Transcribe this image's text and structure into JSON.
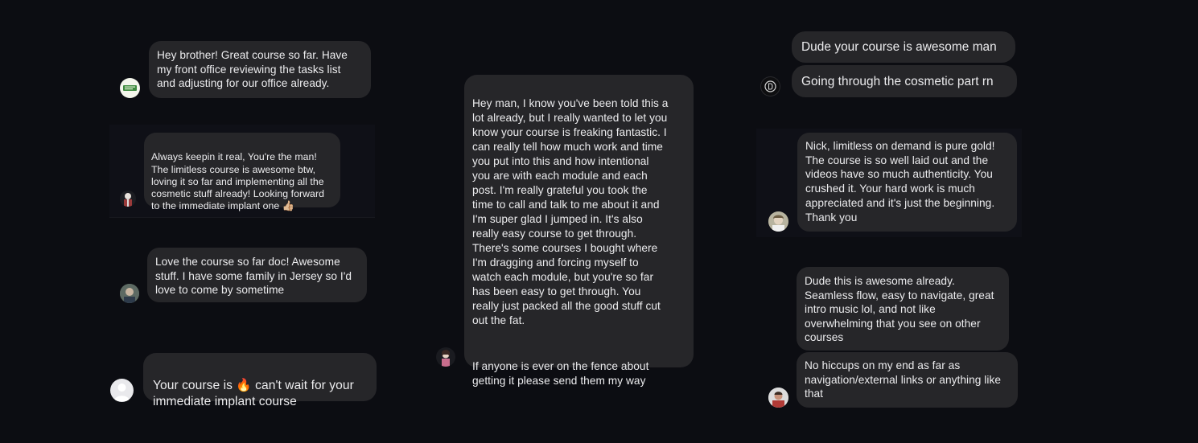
{
  "messages": {
    "m1": "Hey brother! Great course so far.  Have\nmy front office reviewing the tasks list\nand adjusting for our office already.",
    "m2": "Always keepin it real, You're the man!\nThe limitless course is awesome btw,\nloving it so far and implementing all the\ncosmetic stuff already! Looking forward\nto the immediate implant one",
    "m2_emoji": "👍🏼",
    "m3": "Love the course so far doc! Awesome\nstuff. I have some family in Jersey so I'd\nlove to come by sometime",
    "m4_part1": "Your course is ",
    "m4_emoji": "🔥",
    "m4_part2": " can't wait for your\nimmediate implant course",
    "m5_p1": "Hey man, I know you've been told this a\nlot already, but I really wanted to let you\nknow your course is freaking fantastic. I\ncan really tell how much work and time\nyou put into this and how intentional\nyou are with each module and each\npost.  I'm really grateful you took the\ntime to call and talk to me about it and\nI'm super glad I jumped in. It's also\nreally easy course to get through.\nThere's some courses I bought where\nI'm dragging and forcing myself to\nwatch each module, but you're so far\nhas been easy to get through.  You\nreally just packed all the good stuff cut\nout the fat.",
    "m5_p2": "If anyone is ever on the fence about\ngetting it please send them my way",
    "m6": "Dude your course is awesome man",
    "m7": "Going through the cosmetic part rn",
    "m8": "Nick, limitless on demand is pure gold!\nThe course is so well laid out and the\nvideos have so much authenticity. You\ncrushed it. Your hard work is much\nappreciated and it's just the beginning.\nThank you",
    "m9": "Dude this is awesome already.\nSeamless flow, easy to navigate, great\nintro music lol, and not like\noverwhelming that you see on other\ncourses",
    "m10": "No hiccups on my end as far as\nnavigation/external links or anything like\nthat"
  },
  "avatars": {
    "a1": "logo-avatar",
    "a2": "person-avatar",
    "a3": "person-avatar",
    "a4": "default-avatar",
    "a5": "person-avatar",
    "a6": "logo-avatar",
    "a7": "person-avatar",
    "a8": "person-avatar"
  },
  "colors": {
    "background": "#0c0d12",
    "bubble": "#262629",
    "text": "#ececee",
    "fire": "#f26b1d"
  }
}
